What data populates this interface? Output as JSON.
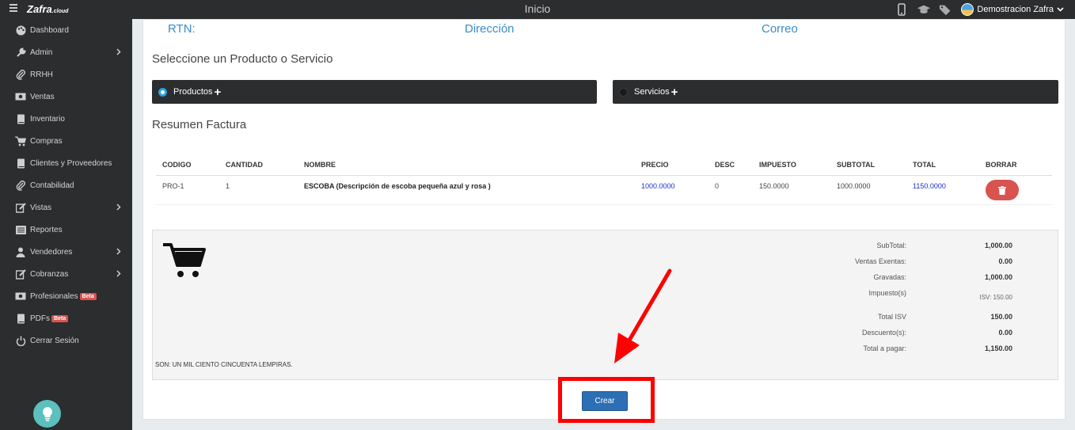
{
  "topbar": {
    "brand": "Zafra",
    "brand_suffix": ".cloud",
    "title": "Inicio",
    "user_name": "Demostracion Zafra"
  },
  "sidebar": {
    "items": [
      {
        "label": "Dashboard",
        "icon": "palette-icon",
        "has_chevron": false
      },
      {
        "label": "Admin",
        "icon": "wrench-icon",
        "has_chevron": true
      },
      {
        "label": "RRHH",
        "icon": "paperclip-icon",
        "has_chevron": false
      },
      {
        "label": "Ventas",
        "icon": "money-icon",
        "has_chevron": false
      },
      {
        "label": "Inventario",
        "icon": "book-icon",
        "has_chevron": false
      },
      {
        "label": "Compras",
        "icon": "cart-icon",
        "has_chevron": false
      },
      {
        "label": "Clientes y Proveedores",
        "icon": "book-icon",
        "has_chevron": false
      },
      {
        "label": "Contabilidad",
        "icon": "paperclip-icon",
        "has_chevron": false
      },
      {
        "label": "Vistas",
        "icon": "edit-icon",
        "has_chevron": true
      },
      {
        "label": "Reportes",
        "icon": "list-icon",
        "has_chevron": false
      },
      {
        "label": "Vendedores",
        "icon": "user-icon",
        "has_chevron": true
      },
      {
        "label": "Cobranzas",
        "icon": "edit-icon",
        "has_chevron": true
      },
      {
        "label": "Profesionales",
        "icon": "money-icon",
        "has_chevron": false,
        "badge": "Beta"
      },
      {
        "label": "PDFs",
        "icon": "book-icon",
        "has_chevron": false,
        "badge": "Beta"
      },
      {
        "label": "Cerrar Sesión",
        "icon": "power-icon",
        "has_chevron": false
      }
    ]
  },
  "header": {
    "rtn_label": "RTN:",
    "direccion_label": "Dirección",
    "correo_label": "Correo"
  },
  "select_section": {
    "title": "Seleccione un Producto o Servicio",
    "productos_label": "Productos",
    "servicios_label": "Servicios"
  },
  "invoice": {
    "title": "Resumen Factura",
    "columns": [
      "CODIGO",
      "CANTIDAD",
      "NOMBRE",
      "PRECIO",
      "DESC",
      "IMPUESTO",
      "SUBTOTAL",
      "TOTAL",
      "BORRAR"
    ],
    "rows": [
      {
        "codigo": "PRO-1",
        "cantidad": "1",
        "nombre": "ESCOBA (Descripción de escoba pequeña azul y rosa )",
        "precio": "1000.0000",
        "desc": "0",
        "impuesto": "150.0000",
        "subtotal": "1000.0000",
        "total": "1150.0000"
      }
    ]
  },
  "summary": {
    "subtotal_label": "SubTotal:",
    "subtotal_value": "1,000.00",
    "exentas_label": "Ventas Exentas:",
    "exentas_value": "0.00",
    "gravadas_label": "Gravadas:",
    "gravadas_value": "1,000.00",
    "impuestos_label": "Impuesto(s)",
    "impuestos_value": "ISV: 150.00",
    "total_isv_label": "Total ISV",
    "total_isv_value": "150.00",
    "descuentos_label": "Descuento(s):",
    "descuentos_value": "0.00",
    "total_pagar_label": "Total a pagar:",
    "total_pagar_value": "1,150.00",
    "amount_words": "SON: UN MIL CIENTO CINCUENTA LEMPIRAS."
  },
  "actions": {
    "crear_label": "Crear"
  },
  "colors": {
    "accent": "#3a8dc8",
    "sidebar_bg": "#2b2d2f",
    "danger": "#d9534f",
    "primary_button": "#2d6fb5",
    "annotation_red": "#ff0000"
  }
}
